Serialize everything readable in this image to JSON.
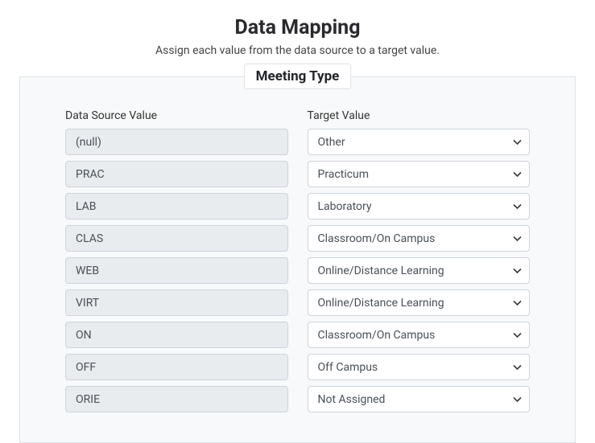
{
  "header": {
    "title": "Data Mapping",
    "subtitle": "Assign each value from the data source to a target value."
  },
  "panel": {
    "legend": "Meeting Type",
    "source_header": "Data Source Value",
    "target_header": "Target Value",
    "rows": [
      {
        "source": "(null)",
        "target": "Other"
      },
      {
        "source": "PRAC",
        "target": "Practicum"
      },
      {
        "source": "LAB",
        "target": "Laboratory"
      },
      {
        "source": "CLAS",
        "target": "Classroom/On Campus"
      },
      {
        "source": "WEB",
        "target": "Online/Distance Learning"
      },
      {
        "source": "VIRT",
        "target": "Online/Distance Learning"
      },
      {
        "source": "ON",
        "target": "Classroom/On Campus"
      },
      {
        "source": "OFF",
        "target": "Off Campus"
      },
      {
        "source": "ORIE",
        "target": "Not Assigned"
      }
    ]
  }
}
